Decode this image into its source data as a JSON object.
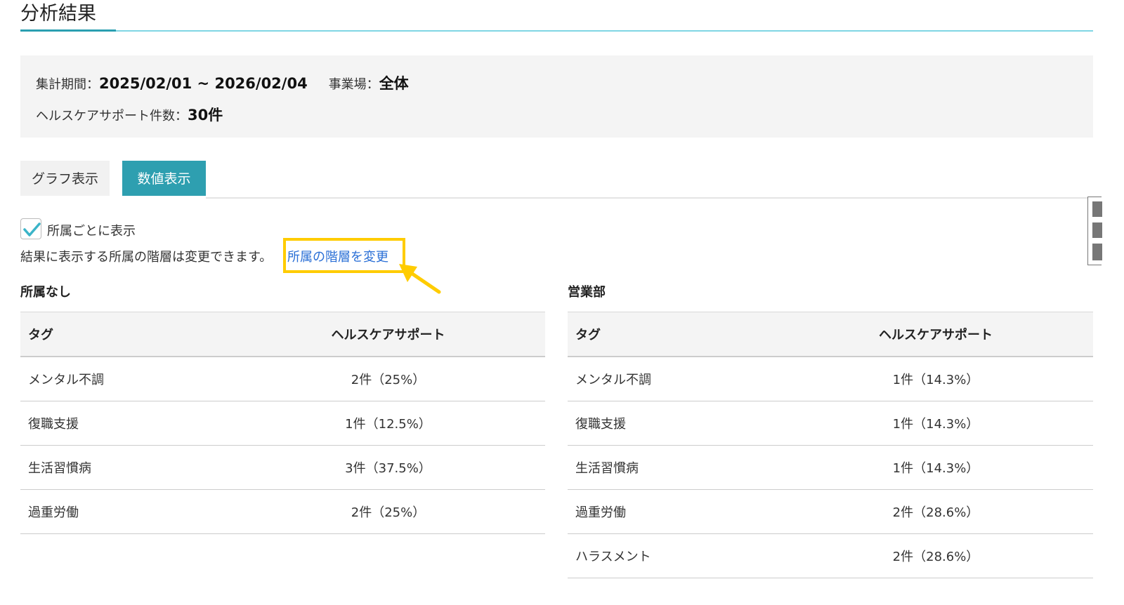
{
  "page": {
    "title": "分析結果"
  },
  "summary": {
    "period_label": "集計期間：",
    "period_value": "2025/02/01 ~ 2026/02/04",
    "site_label": "事業場：",
    "site_value": "全体",
    "count_label": "ヘルスケアサポート件数：",
    "count_value": "30件"
  },
  "tabs": [
    {
      "label": "グラフ表示",
      "active": false
    },
    {
      "label": "数値表示",
      "active": true
    }
  ],
  "options": {
    "group_checkbox_label": "所属ごとに表示",
    "group_checkbox_checked": true,
    "hint_text": "結果に表示する所属の階層は変更できます。",
    "change_link_label": "所属の階層を変更"
  },
  "colors": {
    "accent": "#2e9fb0",
    "link": "#2a6fd6",
    "highlight": "#ffcc00"
  },
  "sections": [
    {
      "title": "所属なし",
      "headers": [
        "タグ",
        "ヘルスケアサポート"
      ],
      "rows": [
        [
          "メンタル不調",
          "2件（25%）"
        ],
        [
          "復職支援",
          "1件（12.5%）"
        ],
        [
          "生活習慣病",
          "3件（37.5%）"
        ],
        [
          "過重労働",
          "2件（25%）"
        ]
      ]
    },
    {
      "title": "営業部",
      "headers": [
        "タグ",
        "ヘルスケアサポート"
      ],
      "rows": [
        [
          "メンタル不調",
          "1件（14.3%）"
        ],
        [
          "復職支援",
          "1件（14.3%）"
        ],
        [
          "生活習慣病",
          "1件（14.3%）"
        ],
        [
          "過重労働",
          "2件（28.6%）"
        ],
        [
          "ハラスメント",
          "2件（28.6%）"
        ]
      ]
    }
  ]
}
